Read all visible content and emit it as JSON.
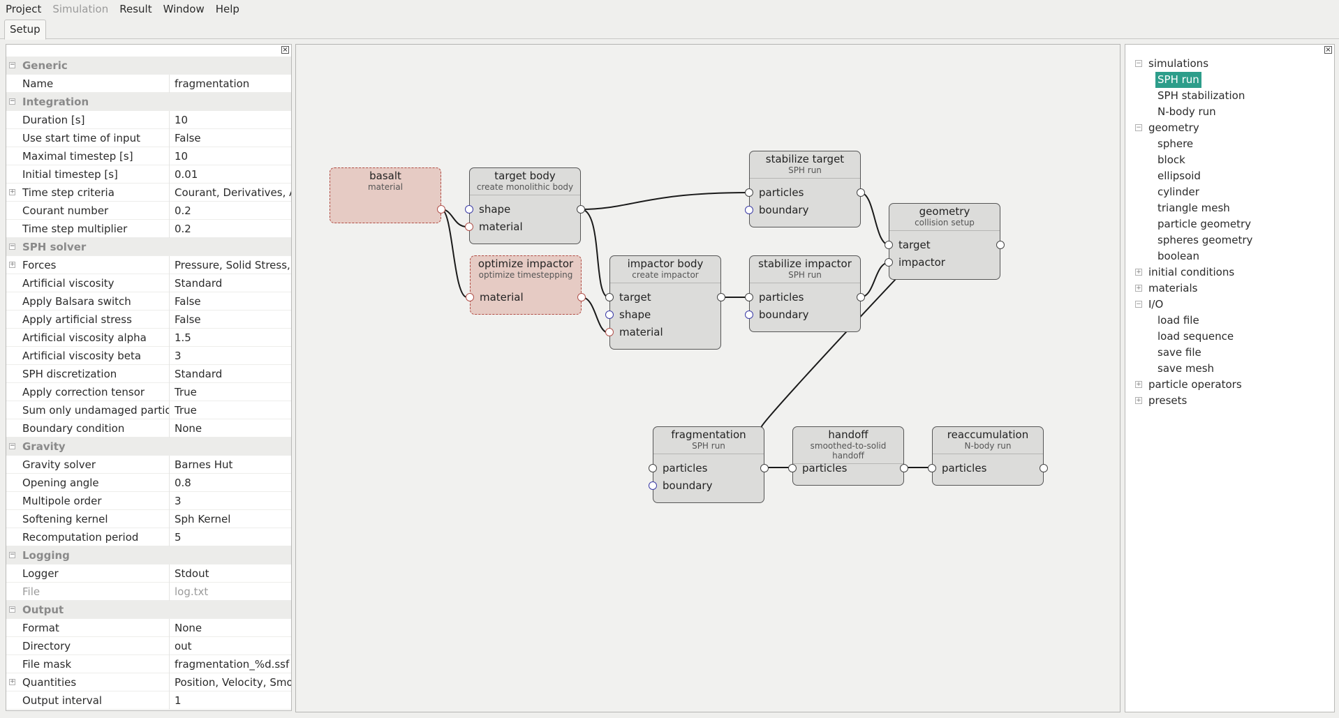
{
  "menubar": {
    "items": [
      {
        "label": "Project",
        "enabled": true
      },
      {
        "label": "Simulation",
        "enabled": false
      },
      {
        "label": "Result",
        "enabled": true
      },
      {
        "label": "Window",
        "enabled": true
      },
      {
        "label": "Help",
        "enabled": true
      }
    ]
  },
  "tabs": {
    "setup": "Setup"
  },
  "properties": {
    "rows": [
      {
        "type": "group",
        "key": "Generic"
      },
      {
        "key": "Name",
        "value": "fragmentation"
      },
      {
        "type": "group",
        "key": "Integration"
      },
      {
        "key": "Duration [s]",
        "value": "10"
      },
      {
        "key": "Use start time of input",
        "value": "False"
      },
      {
        "key": "Maximal timestep [s]",
        "value": "10"
      },
      {
        "key": "Initial timestep [s]",
        "value": "0.01"
      },
      {
        "key": "Time step criteria",
        "value": "Courant, Derivatives, Acce",
        "expandable": true
      },
      {
        "key": "Courant number",
        "value": "0.2"
      },
      {
        "key": "Time step multiplier",
        "value": "0.2"
      },
      {
        "type": "group",
        "key": "SPH solver"
      },
      {
        "key": "Forces",
        "value": "Pressure, Solid Stress, Gra",
        "expandable": true
      },
      {
        "key": "Artificial viscosity",
        "value": "Standard"
      },
      {
        "key": "Apply Balsara switch",
        "value": "False"
      },
      {
        "key": "Apply artificial stress",
        "value": "False"
      },
      {
        "key": "Artificial viscosity alpha",
        "value": "1.5"
      },
      {
        "key": "Artificial viscosity beta",
        "value": "3"
      },
      {
        "key": "SPH discretization",
        "value": "Standard"
      },
      {
        "key": "Apply correction tensor",
        "value": "True"
      },
      {
        "key": "Sum only undamaged particles",
        "value": "True"
      },
      {
        "key": "Boundary condition",
        "value": "None"
      },
      {
        "type": "group",
        "key": "Gravity"
      },
      {
        "key": "Gravity solver",
        "value": "Barnes Hut"
      },
      {
        "key": "Opening angle",
        "value": "0.8"
      },
      {
        "key": "Multipole order",
        "value": "3"
      },
      {
        "key": "Softening kernel",
        "value": "Sph Kernel"
      },
      {
        "key": "Recomputation period",
        "value": "5"
      },
      {
        "type": "group",
        "key": "Logging"
      },
      {
        "key": "Logger",
        "value": "Stdout"
      },
      {
        "key": "File",
        "value": "log.txt",
        "disabled": true
      },
      {
        "type": "group",
        "key": "Output"
      },
      {
        "key": "Format",
        "value": "None"
      },
      {
        "key": "Directory",
        "value": "out"
      },
      {
        "key": "File mask",
        "value": "fragmentation_%d.ssf"
      },
      {
        "key": "Quantities",
        "value": "Position, Velocity, Smoothi",
        "expandable": true
      },
      {
        "key": "Output interval",
        "value": "1"
      }
    ]
  },
  "graph": {
    "nodes": {
      "basalt": {
        "title": "basalt",
        "subtitle": "material"
      },
      "target_body": {
        "title": "target body",
        "subtitle": "create monolithic body",
        "ports": [
          "shape",
          "material"
        ]
      },
      "optimize_impactor": {
        "title": "optimize impactor",
        "subtitle": "optimize timestepping",
        "ports": [
          "material"
        ]
      },
      "impactor_body": {
        "title": "impactor body",
        "subtitle": "create impactor",
        "ports": [
          "target",
          "shape",
          "material"
        ]
      },
      "stabilize_target": {
        "title": "stabilize target",
        "subtitle": "SPH run",
        "ports": [
          "particles",
          "boundary"
        ]
      },
      "stabilize_impactor": {
        "title": "stabilize impactor",
        "subtitle": "SPH run",
        "ports": [
          "particles",
          "boundary"
        ]
      },
      "geometry": {
        "title": "geometry",
        "subtitle": "collision setup",
        "ports": [
          "target",
          "impactor"
        ]
      },
      "fragmentation": {
        "title": "fragmentation",
        "subtitle": "SPH run",
        "ports": [
          "particles",
          "boundary"
        ]
      },
      "handoff": {
        "title": "handoff",
        "subtitle": "smoothed-to-solid handoff",
        "ports": [
          "particles"
        ]
      },
      "reaccumulation": {
        "title": "reaccumulation",
        "subtitle": "N-body run",
        "ports": [
          "particles"
        ]
      }
    }
  },
  "tree": {
    "items": [
      {
        "label": "simulations",
        "level": 0,
        "toggle": "−"
      },
      {
        "label": "SPH run",
        "level": 1,
        "selected": true
      },
      {
        "label": "SPH stabilization",
        "level": 1
      },
      {
        "label": "N-body run",
        "level": 1
      },
      {
        "label": "geometry",
        "level": 0,
        "toggle": "−"
      },
      {
        "label": "sphere",
        "level": 1
      },
      {
        "label": "block",
        "level": 1
      },
      {
        "label": "ellipsoid",
        "level": 1
      },
      {
        "label": "cylinder",
        "level": 1
      },
      {
        "label": "triangle mesh",
        "level": 1
      },
      {
        "label": "particle geometry",
        "level": 1
      },
      {
        "label": "spheres geometry",
        "level": 1
      },
      {
        "label": "boolean",
        "level": 1
      },
      {
        "label": "initial conditions",
        "level": 0,
        "toggle": "+"
      },
      {
        "label": "materials",
        "level": 0,
        "toggle": "+"
      },
      {
        "label": "I/O",
        "level": 0,
        "toggle": "−"
      },
      {
        "label": "load file",
        "level": 1
      },
      {
        "label": "load sequence",
        "level": 1
      },
      {
        "label": "save file",
        "level": 1
      },
      {
        "label": "save mesh",
        "level": 1
      },
      {
        "label": "particle operators",
        "level": 0,
        "toggle": "+"
      },
      {
        "label": "presets",
        "level": 0,
        "toggle": "+"
      }
    ]
  },
  "colors": {
    "selection": "#2d9d8a",
    "material_node": "#e6cbc4",
    "material_border": "#b14b43",
    "node": "#dcdcda"
  }
}
